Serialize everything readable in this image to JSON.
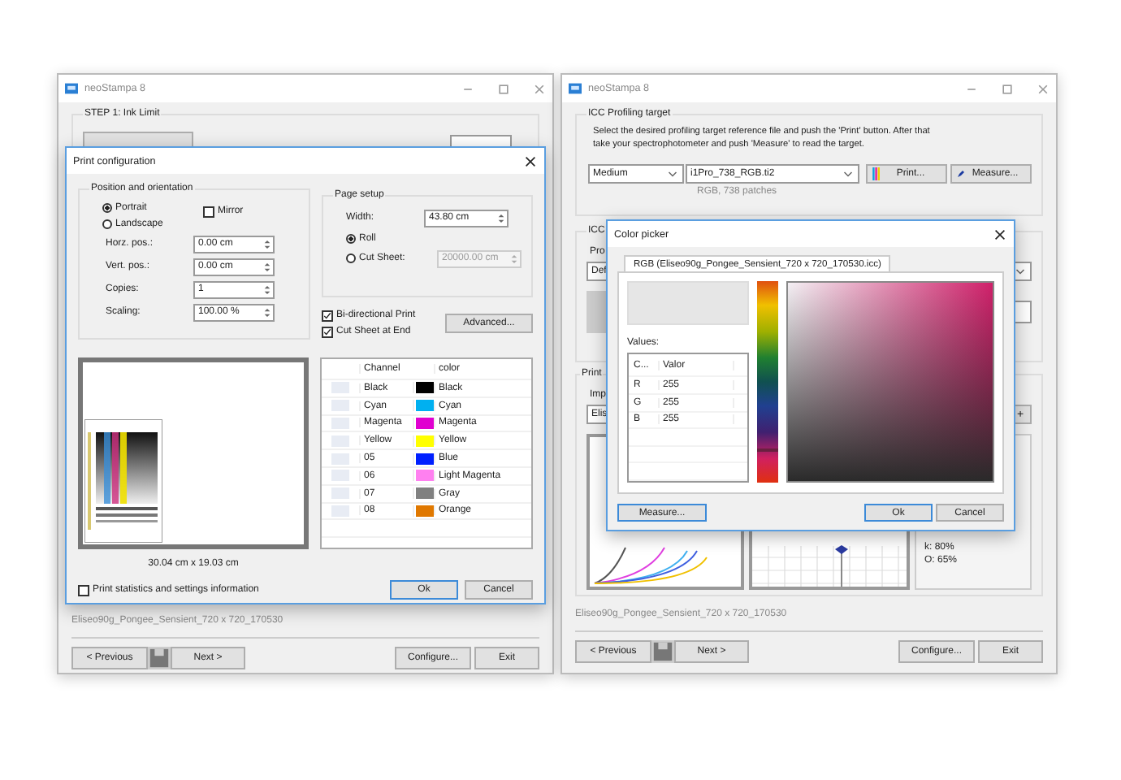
{
  "left_window": {
    "title": "neoStampa 8",
    "group_title": "STEP 1: Ink Limit",
    "profile_name": "Eliseo90g_Pongee_Sensient_720 x 720_170530",
    "buttons": {
      "previous": "< Previous",
      "next": "Next >",
      "configure": "Configure...",
      "exit": "Exit"
    }
  },
  "print_dialog": {
    "title": "Print configuration",
    "position_group": {
      "title": "Position and orientation",
      "orientations": [
        {
          "label": "Portrait",
          "selected": true
        },
        {
          "label": "Landscape",
          "selected": false
        }
      ],
      "mirror": {
        "label": "Mirror",
        "checked": false
      },
      "fields": [
        {
          "label": "Horz. pos.:",
          "value": "0.00 cm"
        },
        {
          "label": "Vert. pos.:",
          "value": "0.00 cm"
        },
        {
          "label": "Copies:",
          "value": "1"
        },
        {
          "label": "Scaling:",
          "value": "100.00 %"
        }
      ]
    },
    "page_setup": {
      "title": "Page setup",
      "width_label": "Width:",
      "width_value": "43.80 cm",
      "modes": [
        {
          "label": "Roll",
          "selected": true
        },
        {
          "label": "Cut Sheet:",
          "selected": false
        }
      ],
      "cut_sheet_value": "20000.00 cm",
      "cut_sheet_disabled": true
    },
    "options": [
      {
        "label": "Bi-directional Print",
        "checked": true
      },
      {
        "label": "Cut Sheet at End",
        "checked": true
      }
    ],
    "advanced_button": "Advanced...",
    "preview_size": "30.04 cm x 19.03 cm",
    "channel_table": {
      "columns": [
        "Channel",
        "color"
      ],
      "rows": [
        {
          "channel": "Black",
          "color_name": "Black",
          "color": "#000000"
        },
        {
          "channel": "Cyan",
          "color_name": "Cyan",
          "color": "#00b0f0"
        },
        {
          "channel": "Magenta",
          "color_name": "Magenta",
          "color": "#e000d0"
        },
        {
          "channel": "Yellow",
          "color_name": "Yellow",
          "color": "#ffff00"
        },
        {
          "channel": "05",
          "color_name": "Blue",
          "color": "#0020ff"
        },
        {
          "channel": "06",
          "color_name": "Light Magenta",
          "color": "#ff80f0"
        },
        {
          "channel": "07",
          "color_name": "Gray",
          "color": "#808080"
        },
        {
          "channel": "08",
          "color_name": "Orange",
          "color": "#e07800"
        }
      ]
    },
    "statistics": {
      "label": "Print statistics and settings information",
      "checked": false
    },
    "ok": "Ok",
    "cancel": "Cancel"
  },
  "right_window": {
    "title": "neoStampa 8",
    "target_group": {
      "title": "ICC Profiling target",
      "description_lines": [
        "Select the desired profiling target reference file and push the 'Print' button. After that",
        "take your spectrophotometer and push 'Measure' to read the target."
      ],
      "medium": "Medium",
      "target_file": "i1Pro_738_RGB.ti2",
      "print_button": "Print...",
      "measure_button": "Measure...",
      "patches": "RGB, 738 patches"
    },
    "profile_group": {
      "title": "ICC",
      "label": "Pro",
      "dropdown": "Def"
    },
    "printer_group": {
      "title": "Print",
      "label": "Imp",
      "dropdown": "Elis",
      "add_button": "+",
      "ink_readings": [
        "k: 80%",
        "O: 65%"
      ]
    },
    "profile_name": "Eliseo90g_Pongee_Sensient_720 x 720_170530",
    "buttons": {
      "previous": "< Previous",
      "next": "Next >",
      "configure": "Configure...",
      "exit": "Exit"
    }
  },
  "color_picker": {
    "title": "Color picker",
    "tab": "RGB (Eliseo90g_Pongee_Sensient_720 x 720_170530.icc)",
    "values_label": "Values:",
    "hue": {
      "level": 0.17
    },
    "columns": [
      "C...",
      "Valor"
    ],
    "values": [
      {
        "channel": "R",
        "value": "255"
      },
      {
        "channel": "G",
        "value": "255"
      },
      {
        "channel": "B",
        "value": "255"
      }
    ],
    "measure_button": "Measure...",
    "ok": "Ok",
    "cancel": "Cancel"
  }
}
